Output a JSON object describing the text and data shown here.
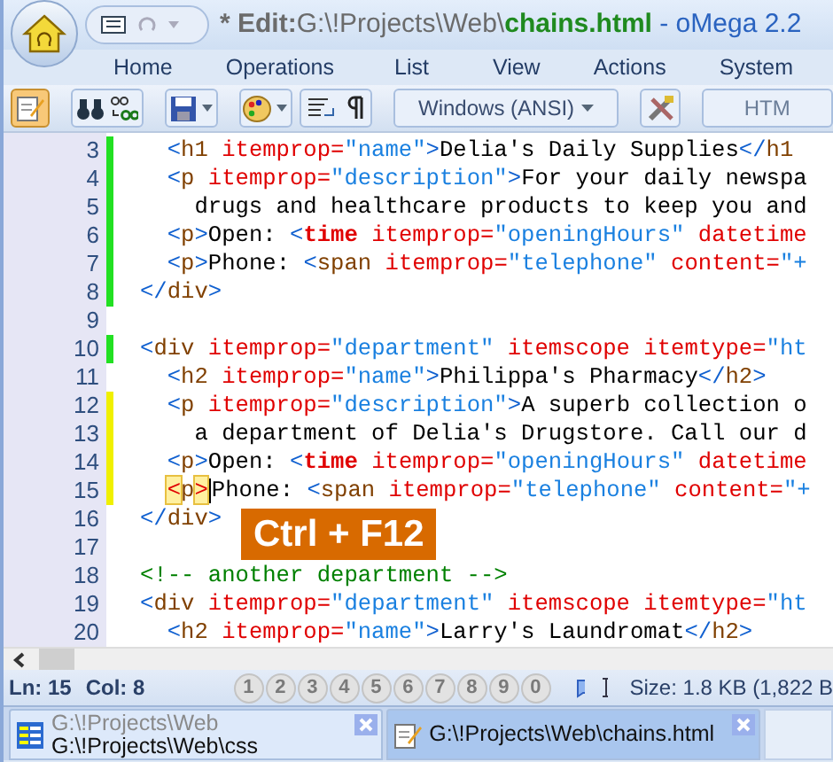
{
  "window": {
    "title_parts": [
      {
        "kind": "flag",
        "text": "* Edit:"
      },
      {
        "kind": "path",
        "text": "G:\\!Projects\\Web\\"
      },
      {
        "kind": "file",
        "text": "chains.html"
      },
      {
        "kind": "app",
        "text": " - oMega 2.2"
      }
    ]
  },
  "ribbon_tabs": [
    {
      "label": "Home",
      "selected": false
    },
    {
      "label": "Operations",
      "selected": false
    },
    {
      "label": "List",
      "selected": false
    },
    {
      "label": "View",
      "selected": false
    },
    {
      "label": "Actions",
      "selected": false
    },
    {
      "label": "System",
      "selected": false
    }
  ],
  "toolbar": {
    "edit_mode_on": true,
    "encoding": "Windows (ANSI)",
    "format_button": "HTM"
  },
  "editor": {
    "lines": [
      {
        "number": "3",
        "color": "#22e022",
        "tokens": [
          {
            "kind": "punct",
            "text": "  <"
          },
          {
            "kind": "tag",
            "text": "h1"
          },
          {
            "kind": "attr",
            "text": " itemprop="
          },
          {
            "kind": "string",
            "text": "\"name\""
          },
          {
            "kind": "punct",
            "text": ">"
          },
          {
            "kind": "text",
            "text": "Delia's Daily Supplies"
          },
          {
            "kind": "punct",
            "text": "</"
          },
          {
            "kind": "tag",
            "text": "h1"
          }
        ]
      },
      {
        "number": "4",
        "color": "#22e022",
        "tokens": [
          {
            "kind": "punct",
            "text": "  <"
          },
          {
            "kind": "tag",
            "text": "p"
          },
          {
            "kind": "attr",
            "text": " itemprop="
          },
          {
            "kind": "string",
            "text": "\"description\""
          },
          {
            "kind": "punct",
            "text": ">"
          },
          {
            "kind": "text",
            "text": "For your daily newspa"
          }
        ]
      },
      {
        "number": "5",
        "color": "#22e022",
        "tokens": [
          {
            "kind": "text",
            "text": "    drugs and healthcare products to keep you and"
          }
        ]
      },
      {
        "number": "6",
        "color": "#22e022",
        "tokens": [
          {
            "kind": "punct",
            "text": "  <"
          },
          {
            "kind": "tag",
            "text": "p"
          },
          {
            "kind": "punct",
            "text": ">"
          },
          {
            "kind": "text",
            "text": "Open: "
          },
          {
            "kind": "punct",
            "text": "<"
          },
          {
            "kind": "keytag",
            "text": "time"
          },
          {
            "kind": "attr",
            "text": " itemprop="
          },
          {
            "kind": "string",
            "text": "\"openingHours\""
          },
          {
            "kind": "attr",
            "text": " datetime"
          }
        ]
      },
      {
        "number": "7",
        "color": "#22e022",
        "tokens": [
          {
            "kind": "punct",
            "text": "  <"
          },
          {
            "kind": "tag",
            "text": "p"
          },
          {
            "kind": "punct",
            "text": ">"
          },
          {
            "kind": "text",
            "text": "Phone: "
          },
          {
            "kind": "punct",
            "text": "<"
          },
          {
            "kind": "tag",
            "text": "span"
          },
          {
            "kind": "attr",
            "text": " itemprop="
          },
          {
            "kind": "string",
            "text": "\"telephone\""
          },
          {
            "kind": "attr",
            "text": " content="
          },
          {
            "kind": "string",
            "text": "\"+"
          }
        ]
      },
      {
        "number": "8",
        "color": "#22e022",
        "tokens": [
          {
            "kind": "punct",
            "text": "</"
          },
          {
            "kind": "tag",
            "text": "div"
          },
          {
            "kind": "punct",
            "text": ">"
          }
        ]
      },
      {
        "number": "9"
      },
      {
        "number": "10",
        "color": "#22e022",
        "tokens": [
          {
            "kind": "punct",
            "text": "<"
          },
          {
            "kind": "tag",
            "text": "div"
          },
          {
            "kind": "attr",
            "text": " itemprop="
          },
          {
            "kind": "string",
            "text": "\"department\""
          },
          {
            "kind": "attr",
            "text": " itemscope itemtype="
          },
          {
            "kind": "string",
            "text": "\"ht"
          }
        ]
      },
      {
        "number": "11",
        "tokens": [
          {
            "kind": "punct",
            "text": "  <"
          },
          {
            "kind": "tag",
            "text": "h2"
          },
          {
            "kind": "attr",
            "text": " itemprop="
          },
          {
            "kind": "string",
            "text": "\"name\""
          },
          {
            "kind": "punct",
            "text": ">"
          },
          {
            "kind": "text",
            "text": "Philippa's Pharmacy"
          },
          {
            "kind": "punct",
            "text": "</"
          },
          {
            "kind": "tag",
            "text": "h2"
          },
          {
            "kind": "punct",
            "text": ">"
          }
        ]
      },
      {
        "number": "12",
        "color": "#f0f000",
        "tokens": [
          {
            "kind": "punct",
            "text": "  <"
          },
          {
            "kind": "tag",
            "text": "p"
          },
          {
            "kind": "attr",
            "text": " itemprop="
          },
          {
            "kind": "string",
            "text": "\"description\""
          },
          {
            "kind": "punct",
            "text": ">"
          },
          {
            "kind": "text",
            "text": "A superb collection o"
          }
        ]
      },
      {
        "number": "13",
        "color": "#f0f000",
        "tokens": [
          {
            "kind": "text",
            "text": "    a department of Delia's Drugstore. Call our d"
          }
        ]
      },
      {
        "number": "14",
        "color": "#f0f000",
        "tokens": [
          {
            "kind": "punct",
            "text": "  <"
          },
          {
            "kind": "tag",
            "text": "p"
          },
          {
            "kind": "punct",
            "text": ">"
          },
          {
            "kind": "text",
            "text": "Open: "
          },
          {
            "kind": "punct",
            "text": "<"
          },
          {
            "kind": "keytag",
            "text": "time"
          },
          {
            "kind": "attr",
            "text": " itemprop="
          },
          {
            "kind": "string",
            "text": "\"openingHours\""
          },
          {
            "kind": "attr",
            "text": " datetime"
          }
        ]
      },
      {
        "number": "15",
        "color": "#f0f000",
        "tokens": [
          {
            "kind": "match",
            "text": "  <"
          },
          {
            "kind": "tag",
            "text": "p"
          },
          {
            "kind": "match",
            "text": ">"
          },
          {
            "kind": "caret"
          },
          {
            "kind": "text",
            "text": "Phone: "
          },
          {
            "kind": "punct",
            "text": "<"
          },
          {
            "kind": "tag",
            "text": "span"
          },
          {
            "kind": "attr",
            "text": " itemprop="
          },
          {
            "kind": "string",
            "text": "\"telephone\""
          },
          {
            "kind": "attr",
            "text": " content="
          },
          {
            "kind": "string",
            "text": "\"+"
          }
        ]
      },
      {
        "number": "16",
        "tokens": [
          {
            "kind": "punct",
            "text": "</"
          },
          {
            "kind": "tag",
            "text": "div"
          },
          {
            "kind": "punct",
            "text": ">"
          }
        ]
      },
      {
        "number": "17"
      },
      {
        "number": "18",
        "tokens": [
          {
            "kind": "comment",
            "text": "<!-- another department -->"
          }
        ]
      },
      {
        "number": "19",
        "tokens": [
          {
            "kind": "punct",
            "text": "<"
          },
          {
            "kind": "tag",
            "text": "div"
          },
          {
            "kind": "attr",
            "text": " itemprop="
          },
          {
            "kind": "string",
            "text": "\"department\""
          },
          {
            "kind": "attr",
            "text": " itemscope itemtype="
          },
          {
            "kind": "string",
            "text": "\"ht"
          }
        ]
      },
      {
        "number": "20",
        "tokens": [
          {
            "kind": "punct",
            "text": "  <"
          },
          {
            "kind": "tag",
            "text": "h2"
          },
          {
            "kind": "attr",
            "text": " itemprop="
          },
          {
            "kind": "string",
            "text": "\"name\""
          },
          {
            "kind": "punct",
            "text": ">"
          },
          {
            "kind": "text",
            "text": "Larry's Laundromat"
          },
          {
            "kind": "punct",
            "text": "</"
          },
          {
            "kind": "tag",
            "text": "h2"
          },
          {
            "kind": "punct",
            "text": ">"
          }
        ]
      }
    ],
    "shortcut_badge": "Ctrl + F12"
  },
  "status_bar": {
    "line": "Ln: 15",
    "column": "Col: 8",
    "bookmarks": [
      {
        "label": "1",
        "disabled": true
      },
      {
        "label": "2",
        "disabled": true
      },
      {
        "label": "3",
        "disabled": true
      },
      {
        "label": "4",
        "disabled": true
      },
      {
        "label": "5",
        "disabled": true
      },
      {
        "label": "6",
        "disabled": true
      },
      {
        "label": "7",
        "disabled": true
      },
      {
        "label": "8",
        "disabled": true
      },
      {
        "label": "9",
        "disabled": true
      },
      {
        "label": "0",
        "disabled": true
      }
    ],
    "size": "Size: 1.8 KB (1,822 B"
  },
  "document_tabs": [
    {
      "kind": "folder",
      "folder": "G:\\!Projects\\Web",
      "path": "G:\\!Projects\\Web\\css",
      "selected": false
    },
    {
      "kind": "file",
      "path": "G:\\!Projects\\Web\\chains.html",
      "selected": true
    }
  ]
}
